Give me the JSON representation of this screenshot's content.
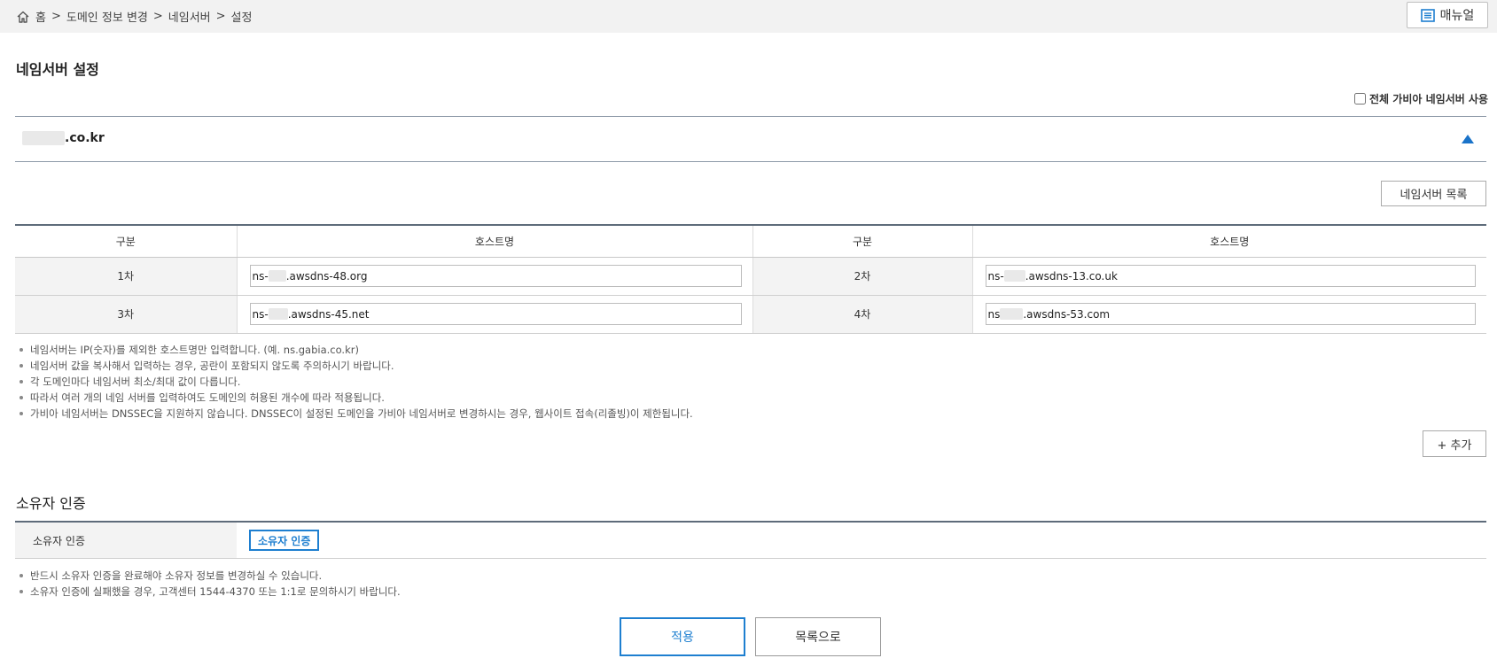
{
  "breadcrumb": {
    "items": [
      "홈",
      "도메인 정보 변경",
      "네임서버",
      "설정"
    ],
    "separator": ">"
  },
  "header": {
    "manual_label": "매뉴얼"
  },
  "nameserver_section": {
    "title": "네임서버 설정",
    "all_gabia_label": "전체 가비아 네임서버 사용",
    "all_gabia_checked": false,
    "domain_suffix": ".co.kr",
    "expanded": true,
    "list_button_label": "네임서버 목록",
    "table": {
      "headers": [
        "구분",
        "호스트명",
        "구분",
        "호스트명"
      ],
      "rows": [
        {
          "label_a": "1차",
          "host_a_prefix": "ns-",
          "host_a_suffix": ".awsdns-48.org",
          "label_b": "2차",
          "host_b_prefix": "ns-",
          "host_b_suffix": ".awsdns-13.co.uk"
        },
        {
          "label_a": "3차",
          "host_a_prefix": "ns-",
          "host_a_suffix": ".awsdns-45.net",
          "label_b": "4차",
          "host_b_prefix": "ns",
          "host_b_suffix": ".awsdns-53.com"
        }
      ]
    },
    "notes": [
      "네임서버는 IP(숫자)를 제외한 호스트명만 입력합니다. (예. ns.gabia.co.kr)",
      "네임서버 값을 복사해서 입력하는 경우, 공란이 포함되지 않도록 주의하시기 바랍니다.",
      "각 도메인마다 네임서버 최소/최대 값이 다릅니다.",
      "따라서 여러 개의 네임 서버를 입력하여도 도메인의 허용된 개수에 따라 적용됩니다.",
      "가비아 네임서버는 DNSSEC을 지원하지 않습니다. DNSSEC이 설정된 도메인을 가비아 네임서버로 변경하시는 경우, 웹사이트 접속(리졸빙)이 제한됩니다."
    ],
    "add_button_label": "+ 추가"
  },
  "owner_section": {
    "title": "소유자 인증",
    "row_label": "소유자 인증",
    "verify_button_label": "소유자 인증",
    "notes": [
      "반드시 소유자 인증을 완료해야 소유자 정보를 변경하실 수 있습니다.",
      "소유자 인증에 실패했을 경우, 고객센터 1544-4370 또는 1:1로 문의하시기 바랍니다."
    ]
  },
  "footer": {
    "apply_label": "적용",
    "back_to_list_label": "목록으로"
  },
  "colors": {
    "accent": "#1e7fd0",
    "table_border": "#5e6b7a",
    "label_bg": "#f3f3f3",
    "topbar_bg": "#f2f2f2"
  },
  "icons": [
    "home-icon",
    "manual-icon",
    "collapse-arrow-icon"
  ]
}
